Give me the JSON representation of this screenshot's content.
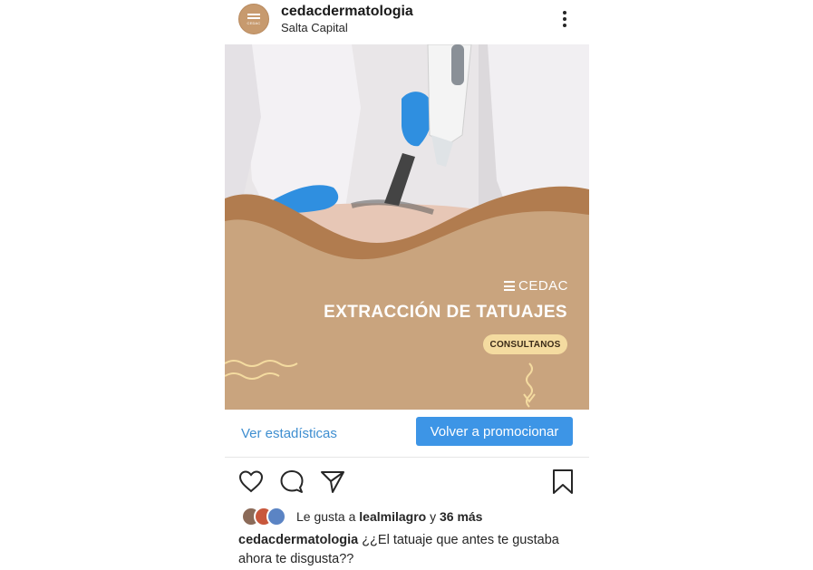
{
  "post": {
    "username": "cedacdermatologia",
    "location": "Salta Capital",
    "avatar_label": "CEDAC",
    "image": {
      "brand": "CEDAC",
      "headline": "EXTRACCIÓN DE TATUAJES",
      "cta": "CONSULTANOS",
      "colors": {
        "panel": "#c9a47e",
        "wave_dark": "#a9744a",
        "cta_bg": "#f4dba0"
      }
    },
    "promo": {
      "stats_link": "Ver estadísticas",
      "promote_button": "Volver a promocionar",
      "accent": "#3d95e6"
    },
    "actions": [
      "heart-icon",
      "comment-icon",
      "share-icon",
      "bookmark-icon"
    ],
    "likes": {
      "prefix": "Le gusta a",
      "user": "lealmilagro",
      "conjunction": "y",
      "others": "36 más"
    },
    "caption": {
      "username": "cedacdermatologia",
      "text": "¿¿El tatuaje que antes te gustaba ahora te disgusta??"
    }
  }
}
